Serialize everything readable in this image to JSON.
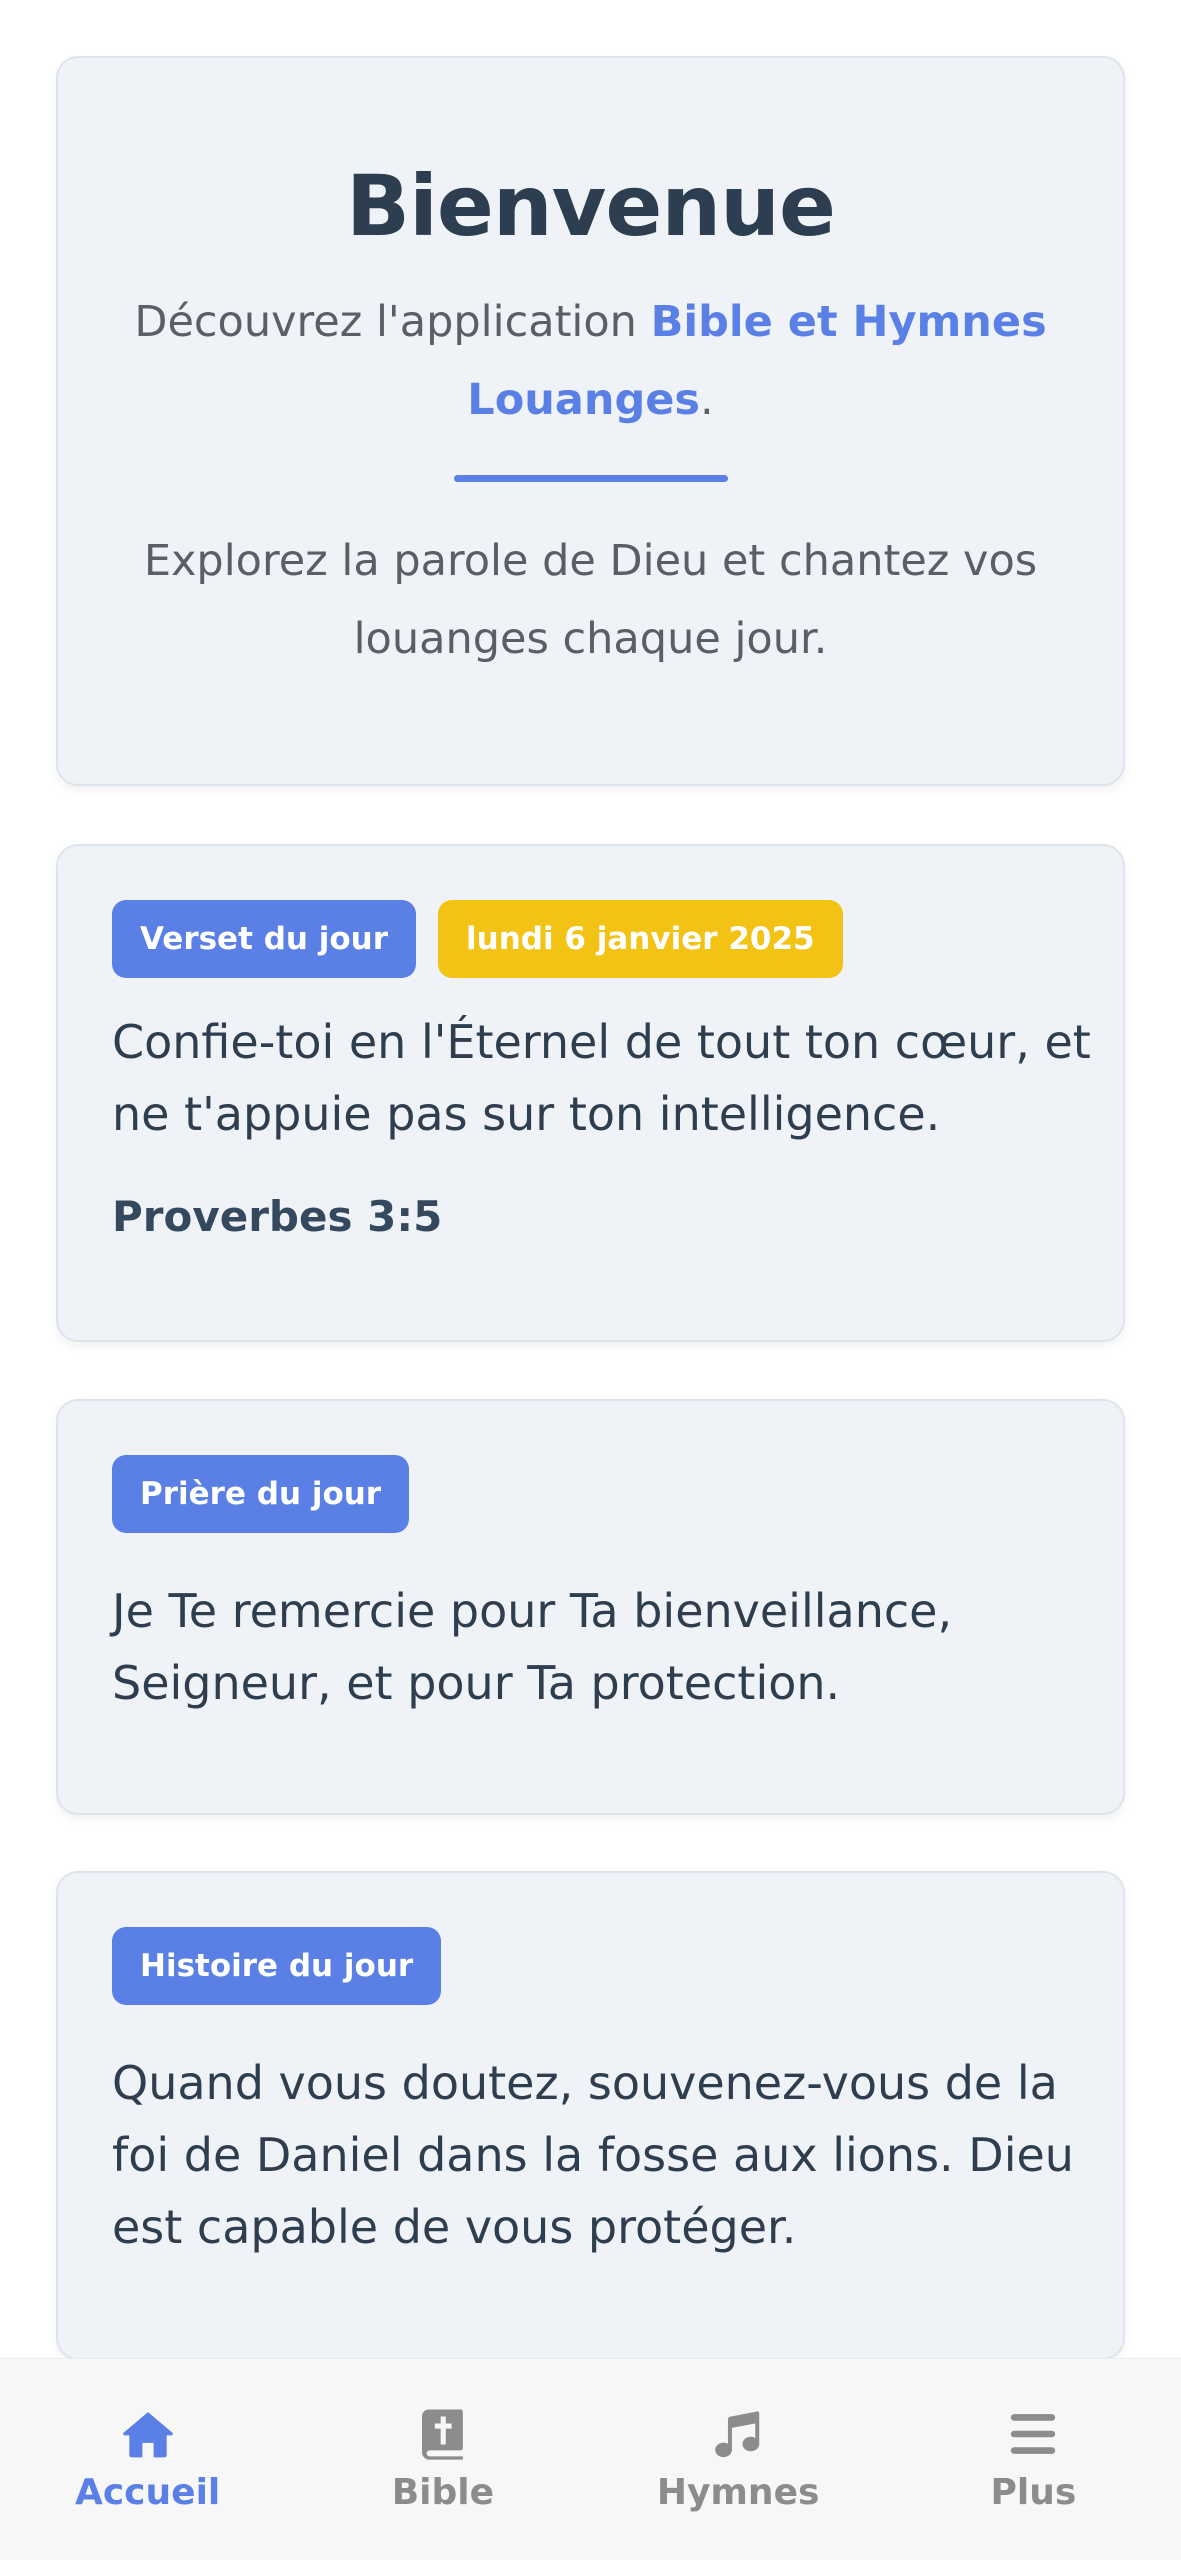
{
  "welcome": {
    "title": "Bienvenue",
    "intro_prefix": "Découvrez l'application ",
    "intro_brand": "Bible et Hymnes Louanges",
    "intro_suffix": ".",
    "explore": "Explorez la parole de Dieu et chantez vos louanges chaque jour."
  },
  "verse": {
    "badge": "Verset du jour",
    "date": "lundi 6 janvier 2025",
    "text": "Confie-toi en l'Éternel de tout ton cœur, et ne t'appuie pas sur ton intelligence.",
    "reference": "Proverbes 3:5"
  },
  "prayer": {
    "badge": "Prière du jour",
    "text": "Je Te remercie pour Ta bienveillance, Seigneur, et pour Ta protection."
  },
  "story": {
    "badge": "Histoire du jour",
    "text": "Quand vous doutez, souvenez-vous de la foi de Daniel dans la fosse aux lions. Dieu est capable de vous protéger."
  },
  "nav": {
    "items": [
      {
        "label": "Accueil",
        "icon": "home-icon",
        "active": true
      },
      {
        "label": "Bible",
        "icon": "bible-icon",
        "active": false
      },
      {
        "label": "Hymnes",
        "icon": "music-note-icon",
        "active": false
      },
      {
        "label": "Plus",
        "icon": "menu-icon",
        "active": false
      }
    ]
  },
  "colors": {
    "accent": "#5a80e6",
    "date_badge": "#f2c314",
    "card_bg": "#eff3f7",
    "text_dark": "#2c3e50",
    "nav_inactive": "#8c8c8c"
  }
}
